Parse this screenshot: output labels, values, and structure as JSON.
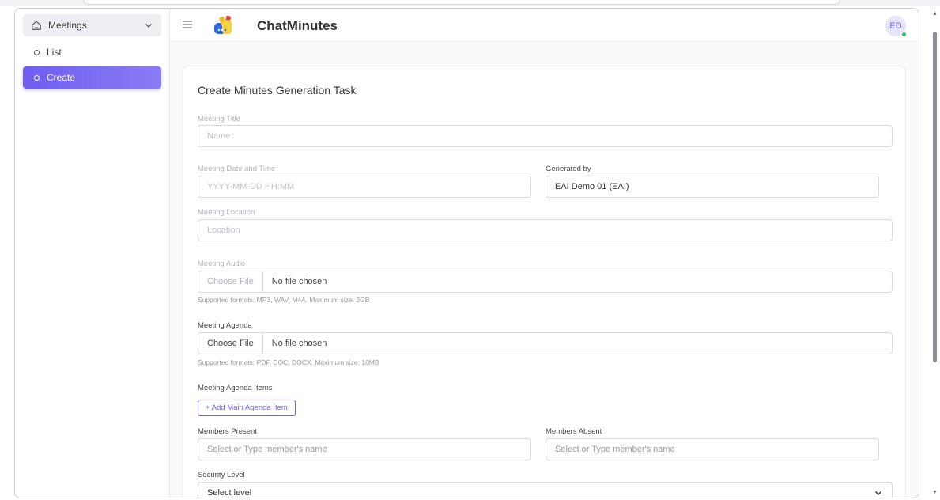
{
  "app": {
    "brand": "ChatMinutes",
    "avatar_initials": "ED",
    "accent": "#6f5ef0"
  },
  "sidebar": {
    "section_label": "Meetings",
    "items": [
      {
        "label": "List",
        "active": false
      },
      {
        "label": "Create",
        "active": true
      }
    ]
  },
  "form": {
    "title": "Create Minutes Generation Task",
    "meeting_title": {
      "label": "Meeting Title",
      "placeholder": "Name"
    },
    "meeting_datetime": {
      "label": "Meeting Date and Time",
      "placeholder": "YYYY-MM-DD HH:MM"
    },
    "generated_by": {
      "label": "Generated by",
      "value": "EAI Demo 01 (EAI)"
    },
    "meeting_location": {
      "label": "Meeting Location",
      "placeholder": "Location"
    },
    "meeting_audio": {
      "label": "Meeting Audio",
      "button": "Choose File",
      "status": "No file chosen",
      "hint": "Supported formats: MP3, WAV, M4A. Maximum size: 2GB"
    },
    "meeting_agenda": {
      "label": "Meeting Agenda",
      "button": "Choose File",
      "status": "No file chosen",
      "hint": "Supported formats: PDF, DOC, DOCX. Maximum size: 10MB"
    },
    "agenda_items": {
      "label": "Meeting Agenda Items",
      "add_button": "+ Add Main Agenda Item"
    },
    "members_present": {
      "label": "Members Present",
      "placeholder": "Select or Type member's name"
    },
    "members_absent": {
      "label": "Members Absent",
      "placeholder": "Select or Type member's name"
    },
    "security_level": {
      "label": "Security Level",
      "selected": "Select level"
    }
  }
}
